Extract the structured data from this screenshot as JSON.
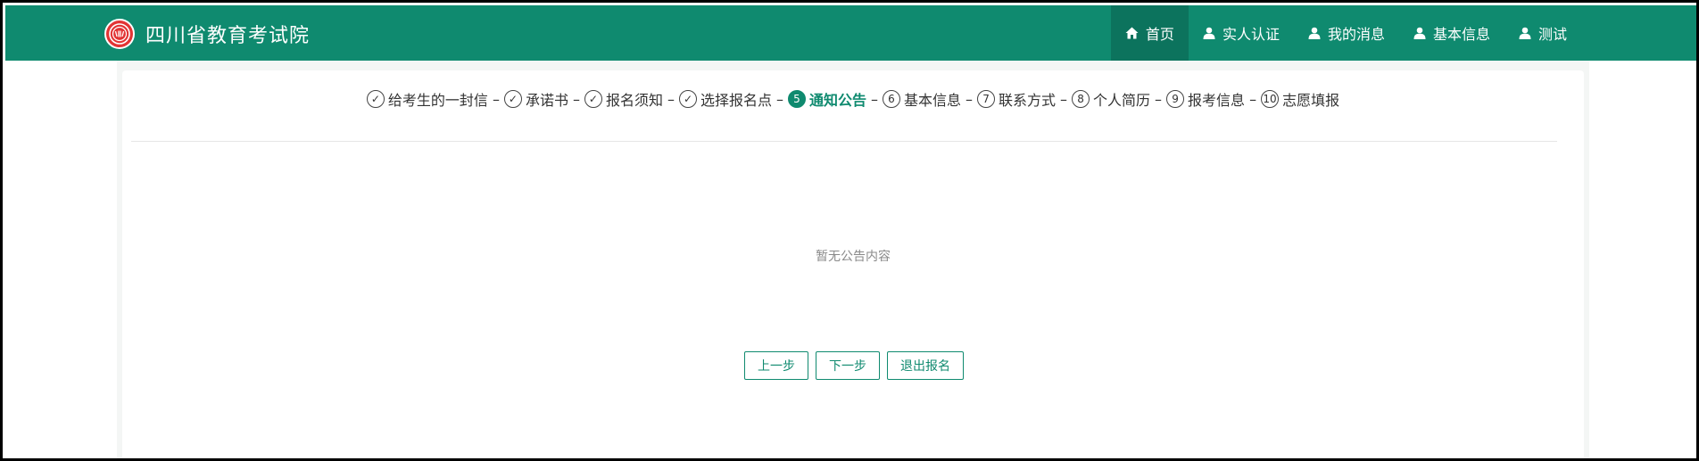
{
  "header": {
    "title": "四川省教育考试院",
    "logo_icon": "emblem-icon",
    "brand_color": "#0f8a6f",
    "nav": [
      {
        "label": "首页",
        "icon": "home-icon",
        "active": true
      },
      {
        "label": "实人认证",
        "icon": "user-icon",
        "active": false
      },
      {
        "label": "我的消息",
        "icon": "user-icon",
        "active": false
      },
      {
        "label": "基本信息",
        "icon": "user-icon",
        "active": false
      },
      {
        "label": "测试",
        "icon": "user-icon",
        "active": false
      }
    ]
  },
  "steps": [
    {
      "label": "给考生的一封信",
      "status": "done",
      "marker": "✓"
    },
    {
      "label": "承诺书",
      "status": "done",
      "marker": "✓"
    },
    {
      "label": "报名须知",
      "status": "done",
      "marker": "✓"
    },
    {
      "label": "选择报名点",
      "status": "done",
      "marker": "✓"
    },
    {
      "label": "通知公告",
      "status": "current",
      "marker": "5"
    },
    {
      "label": "基本信息",
      "status": "todo",
      "marker": "6"
    },
    {
      "label": "联系方式",
      "status": "todo",
      "marker": "7"
    },
    {
      "label": "个人简历",
      "status": "todo",
      "marker": "8"
    },
    {
      "label": "报考信息",
      "status": "todo",
      "marker": "9"
    },
    {
      "label": "志愿填报",
      "status": "todo",
      "marker": "10"
    }
  ],
  "step_separator": "–",
  "main": {
    "empty_text": "暂无公告内容"
  },
  "buttons": {
    "prev": "上一步",
    "next": "下一步",
    "quit": "退出报名"
  }
}
